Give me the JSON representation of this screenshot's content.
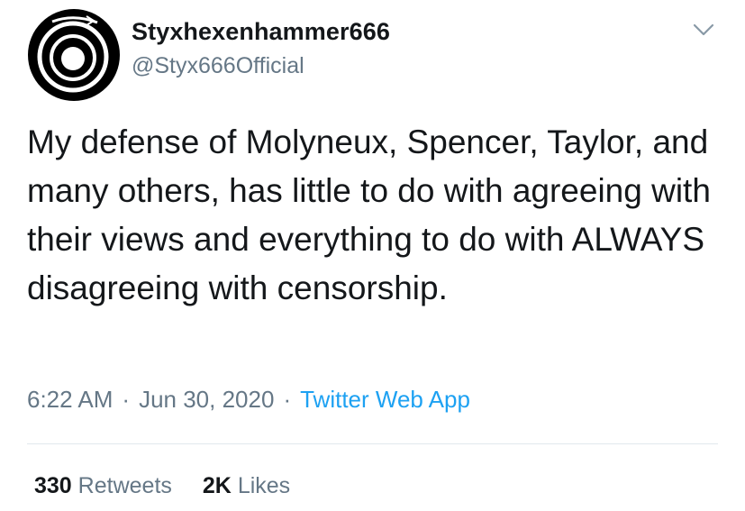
{
  "user": {
    "display_name": "Styxhexenhammer666",
    "handle": "@Styx666Official",
    "avatar_icon": "circular-logo"
  },
  "tweet": {
    "text": "My defense of Molyneux, Spencer, Taylor, and many others, has little to do with agreeing with their views and everything to do with ALWAYS disagreeing with censorship.",
    "time": "6:22 AM",
    "separator": "·",
    "date": "Jun 30, 2020",
    "source": "Twitter Web App"
  },
  "stats": {
    "retweets_count": "330",
    "retweets_label": "Retweets",
    "likes_count": "2K",
    "likes_label": "Likes"
  },
  "colors": {
    "text": "#14171a",
    "secondary": "#657786",
    "link": "#1da1f2",
    "divider": "#e1e8ed"
  }
}
